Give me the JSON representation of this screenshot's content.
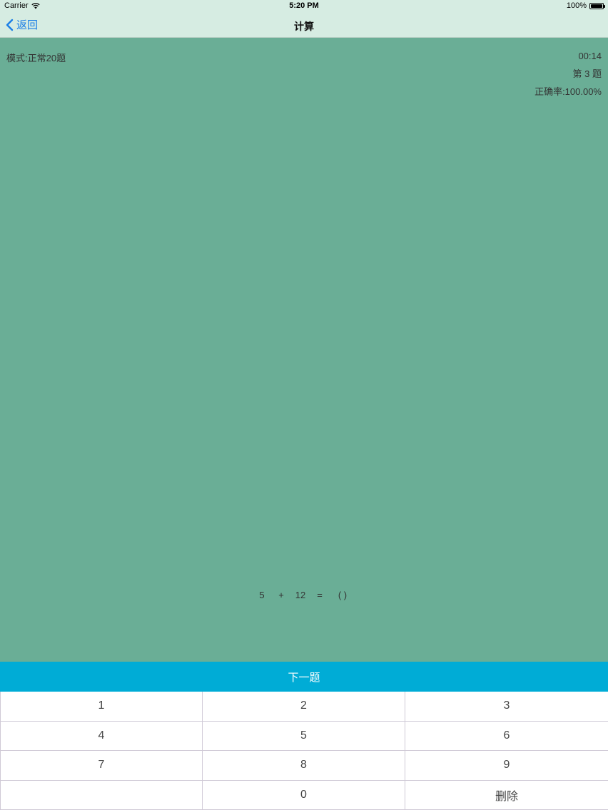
{
  "status_bar": {
    "carrier": "Carrier",
    "time": "5:20 PM",
    "battery": "100%"
  },
  "nav": {
    "back_label": "返回",
    "title": "计算"
  },
  "info": {
    "mode": "模式:正常20题",
    "timer": "00:14",
    "question": "第 3 题",
    "accuracy": "正确率:100.00%"
  },
  "equation": {
    "a": "5",
    "op": "+",
    "b": "12",
    "eq": "=",
    "answer": "(  )"
  },
  "next_button": {
    "label": "下一题"
  },
  "keypad": {
    "keys": [
      "1",
      "2",
      "3",
      "4",
      "5",
      "6",
      "7",
      "8",
      "9",
      "",
      "0",
      "删除"
    ]
  }
}
